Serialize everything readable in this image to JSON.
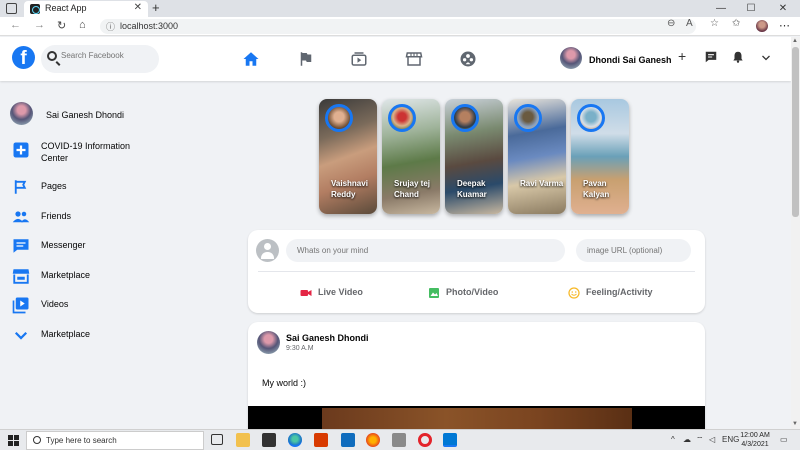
{
  "browser": {
    "tab_title": "React App",
    "url": "localhost:3000"
  },
  "header": {
    "logo": "f",
    "search_placeholder": "Search Facebook",
    "user_name": "Dhondi Sai Ganesh",
    "icons": [
      "home-icon",
      "flag-icon",
      "watch-icon",
      "marketplace-icon",
      "groups-icon",
      "plus-icon",
      "messenger-icon",
      "notifications-icon",
      "chevron-down-icon"
    ]
  },
  "sidebar": {
    "user_name": "Sai Ganesh Dhondi",
    "items": [
      {
        "label": "COVID-19 Information Center",
        "icon": "covid-info-icon"
      },
      {
        "label": "Pages",
        "icon": "flag-icon"
      },
      {
        "label": "Friends",
        "icon": "friends-icon"
      },
      {
        "label": "Messenger",
        "icon": "chat-icon"
      },
      {
        "label": "Marketplace",
        "icon": "storefront-icon"
      },
      {
        "label": "Videos",
        "icon": "video-library-icon"
      },
      {
        "label": "Marketplace",
        "icon": "chevron-down-icon"
      }
    ]
  },
  "stories": [
    {
      "name": "Vaishnavi Reddy"
    },
    {
      "name": "Srujay tej Chand"
    },
    {
      "name": "Deepak Kuamar"
    },
    {
      "name": "Ravi Varma"
    },
    {
      "name": "Pavan Kalyan"
    }
  ],
  "composer": {
    "message_placeholder": "Whats on your mind",
    "image_placeholder": "image URL (optional)",
    "options": [
      {
        "label": "Live Video",
        "color": "#e42645"
      },
      {
        "label": "Photo/Video",
        "color": "#45bd62"
      },
      {
        "label": "Feeling/Activity",
        "color": "#f7b928"
      }
    ]
  },
  "post": {
    "author": "Sai Ganesh Dhondi",
    "time": "9:30 A.M",
    "message": "My world :)"
  },
  "taskbar": {
    "search_text": "Type here to search",
    "lang": "ENG",
    "time": "12:00 AM",
    "date": "4/3/2021"
  },
  "colors": {
    "accent": "#1877f2",
    "background": "#f0f2f5"
  }
}
